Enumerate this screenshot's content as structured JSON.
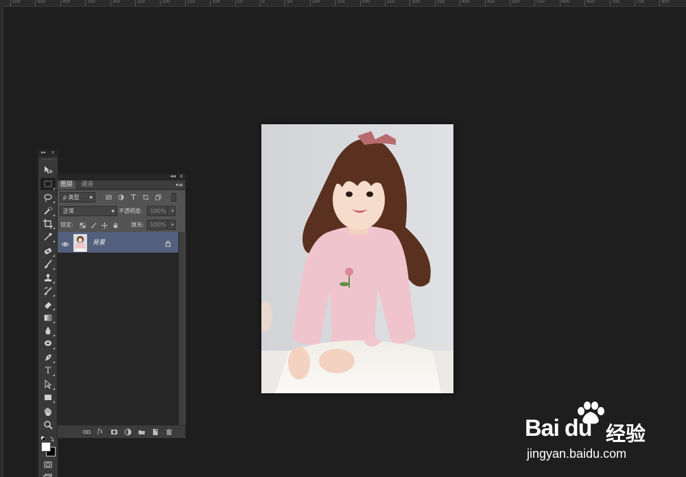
{
  "ruler": {
    "labels": [
      "500",
      "450",
      "400",
      "350",
      "300",
      "250",
      "200",
      "150",
      "100",
      "50",
      "0",
      "50",
      "100",
      "150",
      "200",
      "250",
      "300",
      "350",
      "400",
      "450",
      "500",
      "550",
      "600",
      "650",
      "700",
      "750",
      "800"
    ]
  },
  "toolbar": {
    "header_collapse": "▸▸",
    "header_close": "×",
    "tools": [
      {
        "name": "move-tool",
        "icon": "move-icon"
      },
      {
        "name": "marquee-tool",
        "icon": "marquee-icon"
      },
      {
        "name": "lasso-tool",
        "icon": "lasso-icon"
      },
      {
        "name": "quick-selection-tool",
        "icon": "quick-selection-icon"
      },
      {
        "name": "crop-tool",
        "icon": "crop-icon"
      },
      {
        "name": "eyedropper-tool",
        "icon": "eyedropper-icon"
      },
      {
        "name": "healing-brush-tool",
        "icon": "healing-icon"
      },
      {
        "name": "brush-tool",
        "icon": "brush-icon"
      },
      {
        "name": "clone-stamp-tool",
        "icon": "stamp-icon"
      },
      {
        "name": "history-brush-tool",
        "icon": "history-brush-icon"
      },
      {
        "name": "eraser-tool",
        "icon": "eraser-icon"
      },
      {
        "name": "gradient-tool",
        "icon": "gradient-icon"
      },
      {
        "name": "blur-tool",
        "icon": "blur-icon"
      },
      {
        "name": "dodge-tool",
        "icon": "dodge-icon"
      },
      {
        "name": "pen-tool",
        "icon": "pen-icon"
      },
      {
        "name": "type-tool",
        "icon": "type-icon",
        "glyph": "T"
      },
      {
        "name": "path-selection-tool",
        "icon": "path-selection-icon"
      },
      {
        "name": "rectangle-tool",
        "icon": "rectangle-icon"
      },
      {
        "name": "hand-tool",
        "icon": "hand-icon"
      },
      {
        "name": "zoom-tool",
        "icon": "zoom-icon"
      }
    ],
    "foreground_color": "#ffffff",
    "background_color": "#000000"
  },
  "layers_panel": {
    "header_collapse": "◂◂",
    "header_close": "×",
    "tabs": [
      {
        "label": "图层",
        "active": true
      },
      {
        "label": "通道",
        "active": false
      }
    ],
    "filter_label": "ρ 类型",
    "blend_mode": "正常",
    "opacity_label": "不透明度:",
    "opacity_value": "100%",
    "lock_label": "锁定:",
    "fill_label": "填充:",
    "fill_value": "100%",
    "layers": [
      {
        "name": "背景",
        "visible": true,
        "locked": true,
        "selected": true
      }
    ]
  },
  "colors": {
    "app_bg": "#1e1e1e",
    "panel_bg": "#535353",
    "selected_layer": "#535f7c"
  },
  "watermark": {
    "brand": "Bai",
    "brand_suffix": "du",
    "cn": "经验",
    "url": "jingyan.baidu.com"
  }
}
